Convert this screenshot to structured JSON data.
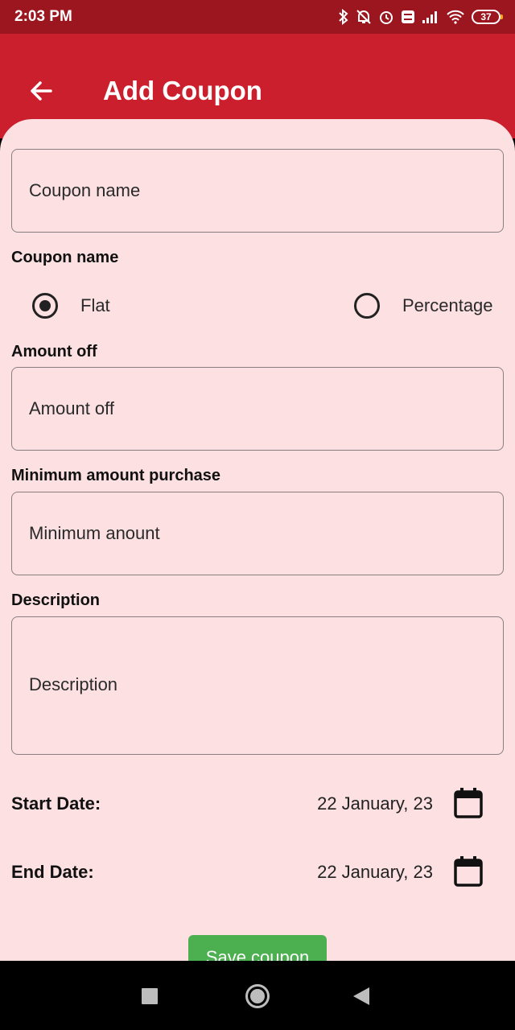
{
  "status_bar": {
    "time": "2:03 PM",
    "battery": "37",
    "icons": [
      "bluetooth-icon",
      "notifications-off-icon",
      "alarm-icon",
      "volte-icon",
      "signal-icon",
      "wifi-icon",
      "battery-icon"
    ]
  },
  "app_bar": {
    "title": "Add Coupon",
    "back_icon": "arrow-back-icon"
  },
  "form": {
    "coupon_name_placeholder": "Coupon name",
    "discount_type_label": "Coupon name",
    "radio_options": [
      {
        "label": "Flat",
        "selected": true
      },
      {
        "label": "Percentage",
        "selected": false
      }
    ],
    "amount_off_label": "Amount off",
    "amount_off_placeholder": "Amount off",
    "min_purchase_label": "Minimum amount purchase",
    "min_purchase_placeholder": "Minimum anount",
    "description_label": "Description",
    "description_placeholder": "Description",
    "start_date_label": "Start Date:",
    "start_date_value": "22 January, 23",
    "end_date_label": "End Date:",
    "end_date_value": "22 January, 23",
    "save_label": "Save coupon"
  },
  "colors": {
    "status_bar": "#9c1620",
    "app_bar": "#cb1f2e",
    "background": "#fce0e2",
    "save_button": "#4caf50"
  }
}
